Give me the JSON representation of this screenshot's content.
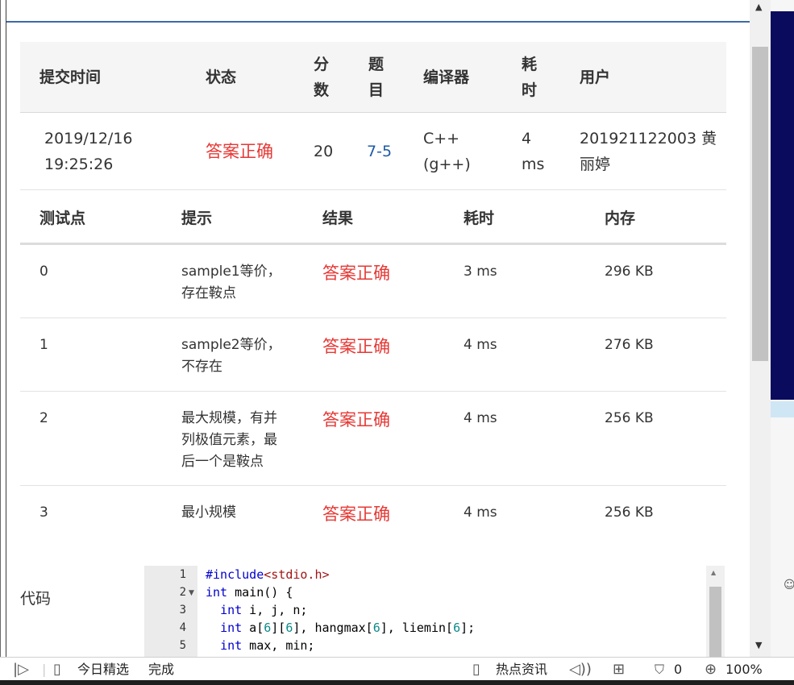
{
  "submission": {
    "headers": [
      "提交时间",
      "状态",
      "分",
      "数",
      "题",
      "目",
      "编译器",
      "耗",
      "时",
      "用户"
    ],
    "time_line1": "2019/12/16",
    "time_line2": "19:25:26",
    "status": "答案正确",
    "score": "20",
    "problem": "7-5",
    "compiler_line1": "C++",
    "compiler_line2": "(g++)",
    "time_cost_line1": "4",
    "time_cost_line2": "ms",
    "user_line1": "201921122003 黄",
    "user_line2": "丽婷"
  },
  "testpoints": {
    "headers": [
      "测试点",
      "提示",
      "结果",
      "耗时",
      "内存"
    ],
    "rows": [
      {
        "id": "0",
        "hint_l1": "sample1等价，",
        "hint_l2": "存在鞍点",
        "hint_l3": "",
        "result": "答案正确",
        "time": "3 ms",
        "memory": "296 KB"
      },
      {
        "id": "1",
        "hint_l1": "sample2等价，",
        "hint_l2": "不存在",
        "hint_l3": "",
        "result": "答案正确",
        "time": "4 ms",
        "memory": "276 KB"
      },
      {
        "id": "2",
        "hint_l1": "最大规模，有并",
        "hint_l2": "列极值元素，最",
        "hint_l3": "后一个是鞍点",
        "result": "答案正确",
        "time": "4 ms",
        "memory": "256 KB"
      },
      {
        "id": "3",
        "hint_l1": "最小规模",
        "hint_l2": "",
        "hint_l3": "",
        "result": "答案正确",
        "time": "4 ms",
        "memory": "256 KB"
      }
    ]
  },
  "code": {
    "label": "代码",
    "line_numbers": [
      "1",
      "2",
      "3",
      "4",
      "5"
    ],
    "lines": [
      {
        "parts": [
          [
            "kw",
            "#include"
          ],
          [
            "str",
            "<stdio.h>"
          ]
        ]
      },
      {
        "parts": [
          [
            "kw",
            "int"
          ],
          [
            "",
            " main() {"
          ]
        ]
      },
      {
        "parts": [
          [
            "",
            "  "
          ],
          [
            "kw",
            "int"
          ],
          [
            "",
            " i, j, n;"
          ]
        ]
      },
      {
        "parts": [
          [
            "",
            "  "
          ],
          [
            "kw",
            "int"
          ],
          [
            "",
            " a["
          ],
          [
            "num",
            "6"
          ],
          [
            "",
            "]["
          ],
          [
            "num",
            "6"
          ],
          [
            "",
            "], hangmax["
          ],
          [
            "num",
            "6"
          ],
          [
            "",
            "], liemin["
          ],
          [
            "num",
            "6"
          ],
          [
            "",
            "];"
          ]
        ]
      },
      {
        "parts": [
          [
            "",
            "  "
          ],
          [
            "kw",
            "int"
          ],
          [
            "",
            " max, min;"
          ]
        ]
      }
    ]
  },
  "statusbar": {
    "today_pick": "今日精选",
    "done": "完成",
    "hot_news": "热点资讯",
    "ad_count": "0",
    "zoom": "100%"
  },
  "colors": {
    "accent_red": "#e53935",
    "link_blue": "#1e5aa8",
    "header_bg": "#f5f5f5"
  }
}
